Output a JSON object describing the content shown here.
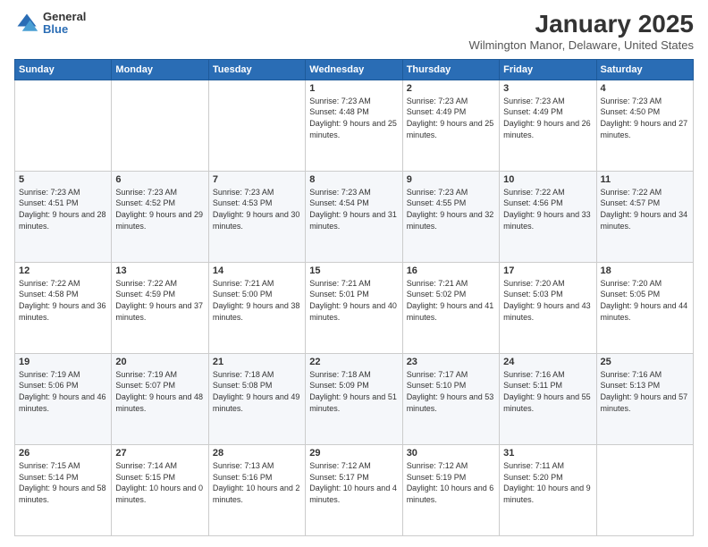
{
  "logo": {
    "general": "General",
    "blue": "Blue"
  },
  "header": {
    "month": "January 2025",
    "location": "Wilmington Manor, Delaware, United States"
  },
  "weekdays": [
    "Sunday",
    "Monday",
    "Tuesday",
    "Wednesday",
    "Thursday",
    "Friday",
    "Saturday"
  ],
  "weeks": [
    [
      {
        "day": "",
        "sunrise": "",
        "sunset": "",
        "daylight": ""
      },
      {
        "day": "",
        "sunrise": "",
        "sunset": "",
        "daylight": ""
      },
      {
        "day": "",
        "sunrise": "",
        "sunset": "",
        "daylight": ""
      },
      {
        "day": "1",
        "sunrise": "Sunrise: 7:23 AM",
        "sunset": "Sunset: 4:48 PM",
        "daylight": "Daylight: 9 hours and 25 minutes."
      },
      {
        "day": "2",
        "sunrise": "Sunrise: 7:23 AM",
        "sunset": "Sunset: 4:49 PM",
        "daylight": "Daylight: 9 hours and 25 minutes."
      },
      {
        "day": "3",
        "sunrise": "Sunrise: 7:23 AM",
        "sunset": "Sunset: 4:49 PM",
        "daylight": "Daylight: 9 hours and 26 minutes."
      },
      {
        "day": "4",
        "sunrise": "Sunrise: 7:23 AM",
        "sunset": "Sunset: 4:50 PM",
        "daylight": "Daylight: 9 hours and 27 minutes."
      }
    ],
    [
      {
        "day": "5",
        "sunrise": "Sunrise: 7:23 AM",
        "sunset": "Sunset: 4:51 PM",
        "daylight": "Daylight: 9 hours and 28 minutes."
      },
      {
        "day": "6",
        "sunrise": "Sunrise: 7:23 AM",
        "sunset": "Sunset: 4:52 PM",
        "daylight": "Daylight: 9 hours and 29 minutes."
      },
      {
        "day": "7",
        "sunrise": "Sunrise: 7:23 AM",
        "sunset": "Sunset: 4:53 PM",
        "daylight": "Daylight: 9 hours and 30 minutes."
      },
      {
        "day": "8",
        "sunrise": "Sunrise: 7:23 AM",
        "sunset": "Sunset: 4:54 PM",
        "daylight": "Daylight: 9 hours and 31 minutes."
      },
      {
        "day": "9",
        "sunrise": "Sunrise: 7:23 AM",
        "sunset": "Sunset: 4:55 PM",
        "daylight": "Daylight: 9 hours and 32 minutes."
      },
      {
        "day": "10",
        "sunrise": "Sunrise: 7:22 AM",
        "sunset": "Sunset: 4:56 PM",
        "daylight": "Daylight: 9 hours and 33 minutes."
      },
      {
        "day": "11",
        "sunrise": "Sunrise: 7:22 AM",
        "sunset": "Sunset: 4:57 PM",
        "daylight": "Daylight: 9 hours and 34 minutes."
      }
    ],
    [
      {
        "day": "12",
        "sunrise": "Sunrise: 7:22 AM",
        "sunset": "Sunset: 4:58 PM",
        "daylight": "Daylight: 9 hours and 36 minutes."
      },
      {
        "day": "13",
        "sunrise": "Sunrise: 7:22 AM",
        "sunset": "Sunset: 4:59 PM",
        "daylight": "Daylight: 9 hours and 37 minutes."
      },
      {
        "day": "14",
        "sunrise": "Sunrise: 7:21 AM",
        "sunset": "Sunset: 5:00 PM",
        "daylight": "Daylight: 9 hours and 38 minutes."
      },
      {
        "day": "15",
        "sunrise": "Sunrise: 7:21 AM",
        "sunset": "Sunset: 5:01 PM",
        "daylight": "Daylight: 9 hours and 40 minutes."
      },
      {
        "day": "16",
        "sunrise": "Sunrise: 7:21 AM",
        "sunset": "Sunset: 5:02 PM",
        "daylight": "Daylight: 9 hours and 41 minutes."
      },
      {
        "day": "17",
        "sunrise": "Sunrise: 7:20 AM",
        "sunset": "Sunset: 5:03 PM",
        "daylight": "Daylight: 9 hours and 43 minutes."
      },
      {
        "day": "18",
        "sunrise": "Sunrise: 7:20 AM",
        "sunset": "Sunset: 5:05 PM",
        "daylight": "Daylight: 9 hours and 44 minutes."
      }
    ],
    [
      {
        "day": "19",
        "sunrise": "Sunrise: 7:19 AM",
        "sunset": "Sunset: 5:06 PM",
        "daylight": "Daylight: 9 hours and 46 minutes."
      },
      {
        "day": "20",
        "sunrise": "Sunrise: 7:19 AM",
        "sunset": "Sunset: 5:07 PM",
        "daylight": "Daylight: 9 hours and 48 minutes."
      },
      {
        "day": "21",
        "sunrise": "Sunrise: 7:18 AM",
        "sunset": "Sunset: 5:08 PM",
        "daylight": "Daylight: 9 hours and 49 minutes."
      },
      {
        "day": "22",
        "sunrise": "Sunrise: 7:18 AM",
        "sunset": "Sunset: 5:09 PM",
        "daylight": "Daylight: 9 hours and 51 minutes."
      },
      {
        "day": "23",
        "sunrise": "Sunrise: 7:17 AM",
        "sunset": "Sunset: 5:10 PM",
        "daylight": "Daylight: 9 hours and 53 minutes."
      },
      {
        "day": "24",
        "sunrise": "Sunrise: 7:16 AM",
        "sunset": "Sunset: 5:11 PM",
        "daylight": "Daylight: 9 hours and 55 minutes."
      },
      {
        "day": "25",
        "sunrise": "Sunrise: 7:16 AM",
        "sunset": "Sunset: 5:13 PM",
        "daylight": "Daylight: 9 hours and 57 minutes."
      }
    ],
    [
      {
        "day": "26",
        "sunrise": "Sunrise: 7:15 AM",
        "sunset": "Sunset: 5:14 PM",
        "daylight": "Daylight: 9 hours and 58 minutes."
      },
      {
        "day": "27",
        "sunrise": "Sunrise: 7:14 AM",
        "sunset": "Sunset: 5:15 PM",
        "daylight": "Daylight: 10 hours and 0 minutes."
      },
      {
        "day": "28",
        "sunrise": "Sunrise: 7:13 AM",
        "sunset": "Sunset: 5:16 PM",
        "daylight": "Daylight: 10 hours and 2 minutes."
      },
      {
        "day": "29",
        "sunrise": "Sunrise: 7:12 AM",
        "sunset": "Sunset: 5:17 PM",
        "daylight": "Daylight: 10 hours and 4 minutes."
      },
      {
        "day": "30",
        "sunrise": "Sunrise: 7:12 AM",
        "sunset": "Sunset: 5:19 PM",
        "daylight": "Daylight: 10 hours and 6 minutes."
      },
      {
        "day": "31",
        "sunrise": "Sunrise: 7:11 AM",
        "sunset": "Sunset: 5:20 PM",
        "daylight": "Daylight: 10 hours and 9 minutes."
      },
      {
        "day": "",
        "sunrise": "",
        "sunset": "",
        "daylight": ""
      }
    ]
  ]
}
